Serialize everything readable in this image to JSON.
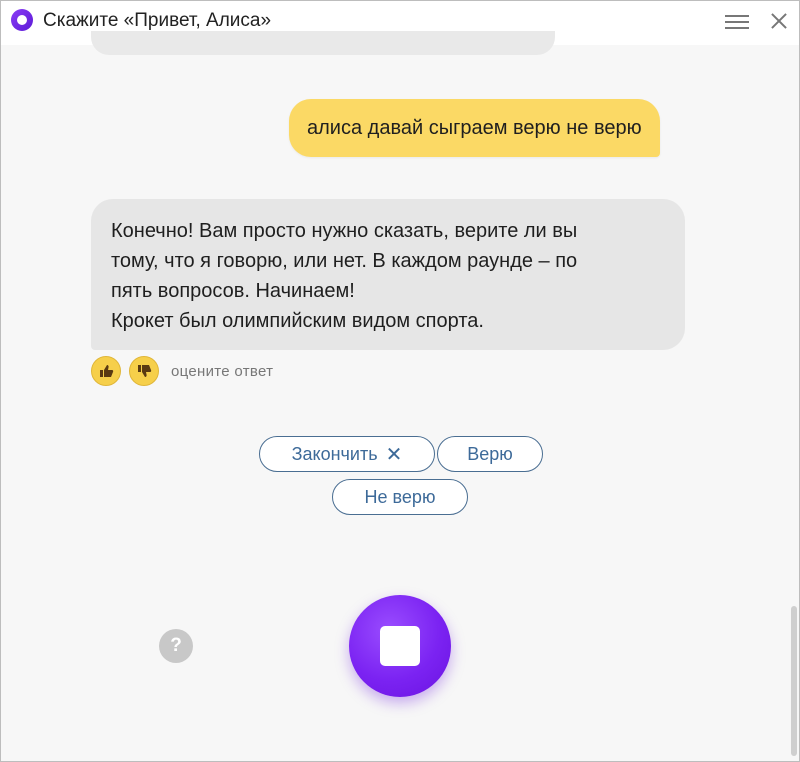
{
  "header": {
    "title": "Скажите «Привет, Алиса»",
    "logo_icon": "alice-logo-icon",
    "menu_icon": "hamburger-menu-icon",
    "close_icon": "close-icon"
  },
  "chat": {
    "user_message": "алиса давай сыграем верю не верю",
    "alice_response_lines": [
      "Конечно! Вам просто нужно сказать, верите ли вы",
      "тому, что я говорю, или нет. В каждом раунде – по",
      "пять вопросов. Начинаем!",
      "Крокет был олимпийским видом спорта."
    ],
    "rating": {
      "label": "оцените ответ",
      "like_icon": "thumbs-up-icon",
      "dislike_icon": "thumbs-down-icon"
    }
  },
  "suggestions": {
    "finish": "Закончить",
    "finish_icon": "✕",
    "believe": "Верю",
    "not_believe": "Не верю"
  },
  "controls": {
    "help_label": "?",
    "mic_icon": "stop-icon"
  },
  "colors": {
    "user_bubble": "#fbd965",
    "alice_bubble": "#e6e6e6",
    "accent_purple": "#7b23f2",
    "suggest_border": "#4a6e92"
  }
}
